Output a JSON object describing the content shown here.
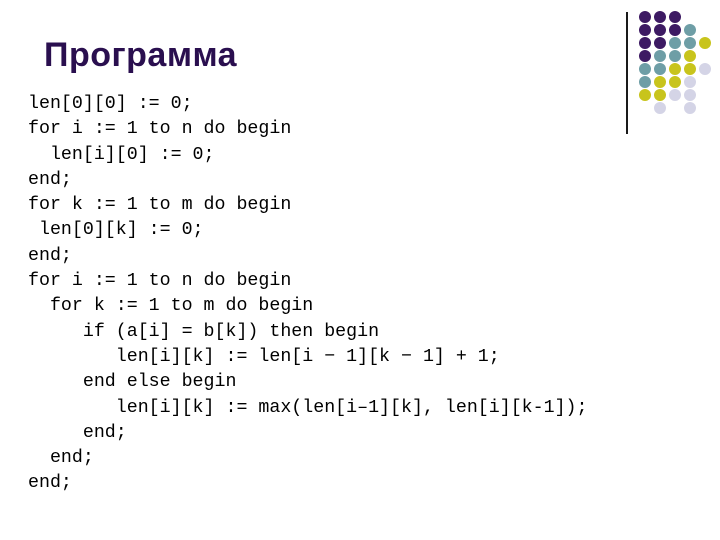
{
  "slide": {
    "title": "Программа",
    "code_lines": [
      "len[0][0] := 0;",
      "for i := 1 to n do begin",
      "  len[i][0] := 0;",
      "end;",
      "for k := 1 to m do begin",
      " len[0][k] := 0;",
      "end;",
      "for i := 1 to n do begin",
      "  for k := 1 to m do begin",
      "     if (a[i] = b[k]) then begin",
      "        len[i][k] := len[i − 1][k − 1] + 1;",
      "     end else begin",
      "        len[i][k] := max(len[i–1][k], len[i][k-1]);",
      "     end;",
      "  end;",
      "end;"
    ]
  },
  "decoration": {
    "colors": {
      "purple": "#3d1a63",
      "teal": "#6e9ea6",
      "yellow": "#c8c41c",
      "lavender": "#d4d4e6"
    },
    "dot_grid": [
      [
        "purple",
        "purple",
        "purple",
        null,
        null
      ],
      [
        "purple",
        "purple",
        "purple",
        "teal",
        null
      ],
      [
        "purple",
        "purple",
        "teal",
        "teal",
        "yellow"
      ],
      [
        "purple",
        "teal",
        "teal",
        "yellow",
        null
      ],
      [
        "teal",
        "teal",
        "yellow",
        "yellow",
        "lavender"
      ],
      [
        "teal",
        "yellow",
        "yellow",
        "lavender",
        null
      ],
      [
        "yellow",
        "yellow",
        "lavender",
        "lavender",
        null
      ],
      [
        null,
        "lavender",
        null,
        "lavender",
        null
      ]
    ]
  }
}
